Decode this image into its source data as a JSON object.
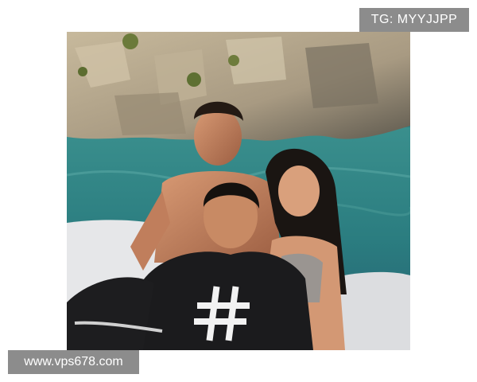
{
  "watermarks": {
    "top_right": "TG: MYYJJPP",
    "bottom_left": "www.vps678.com"
  },
  "photo": {
    "colors": {
      "sea": "#2f8a8c",
      "rock": "#b8a98e",
      "boat": "#e9e9ea",
      "shirt": "#1b1b1d",
      "skin": "#c98a66"
    }
  }
}
